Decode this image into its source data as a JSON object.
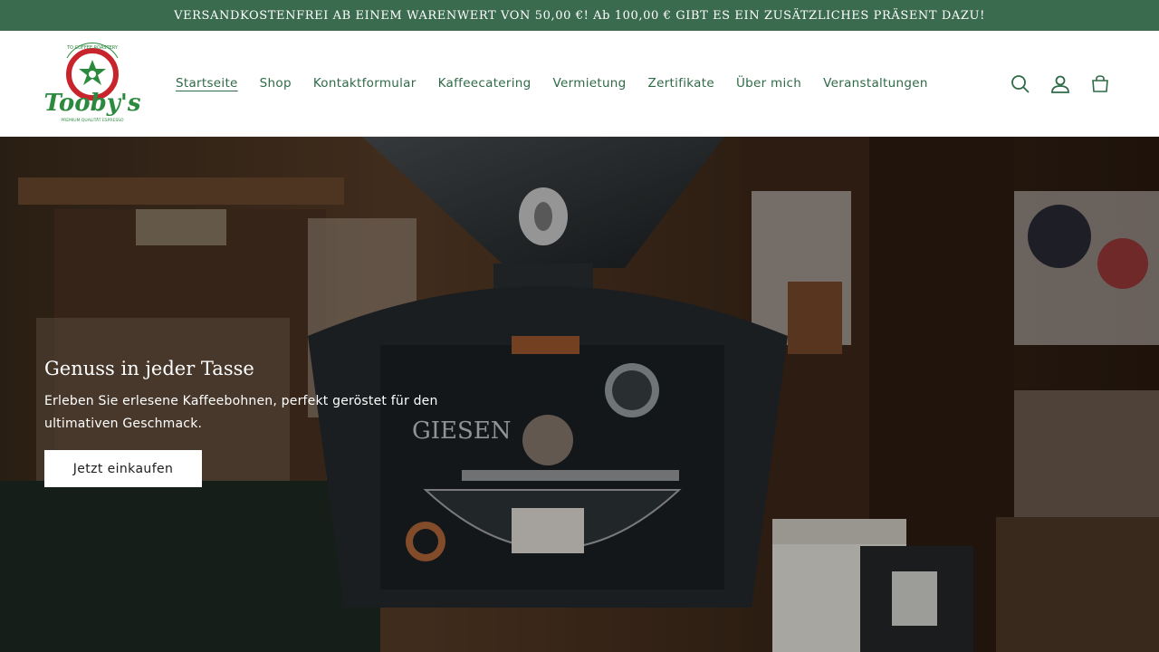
{
  "announcement": {
    "text": "VERSANDKOSTENFREI AB EINEM WARENWERT VON 50,00 €! Ab 100,00 € GIBT ES EIN ZUSÄTZLICHES PRÄSENT DAZU!"
  },
  "logo": {
    "top_text": "TO COFFEE ROASTERY",
    "script_text": "Tooby's",
    "bottom_text": "PREMIUM QUALITÄT ESPRESSO"
  },
  "nav": {
    "items": [
      {
        "label": "Startseite",
        "active": true
      },
      {
        "label": "Shop"
      },
      {
        "label": "Kontaktformular"
      },
      {
        "label": "Kaffeecatering"
      },
      {
        "label": "Vermietung"
      },
      {
        "label": "Zertifikate"
      },
      {
        "label": "Über mich"
      },
      {
        "label": "Veranstaltungen"
      }
    ]
  },
  "header_icons": [
    "search-icon",
    "account-icon",
    "cart-icon"
  ],
  "hero": {
    "title": "Genuss in jeder Tasse",
    "subtitle": "Erleben Sie erlesene Kaffeebohnen, perfekt geröstet für den ultimativen Geschmack.",
    "button_label": "Jetzt einkaufen",
    "machine_brand": "GIESEN"
  },
  "colors": {
    "brand_green": "#3b6b4e",
    "nav_green": "#2f6a47",
    "logo_red": "#c8242b"
  }
}
